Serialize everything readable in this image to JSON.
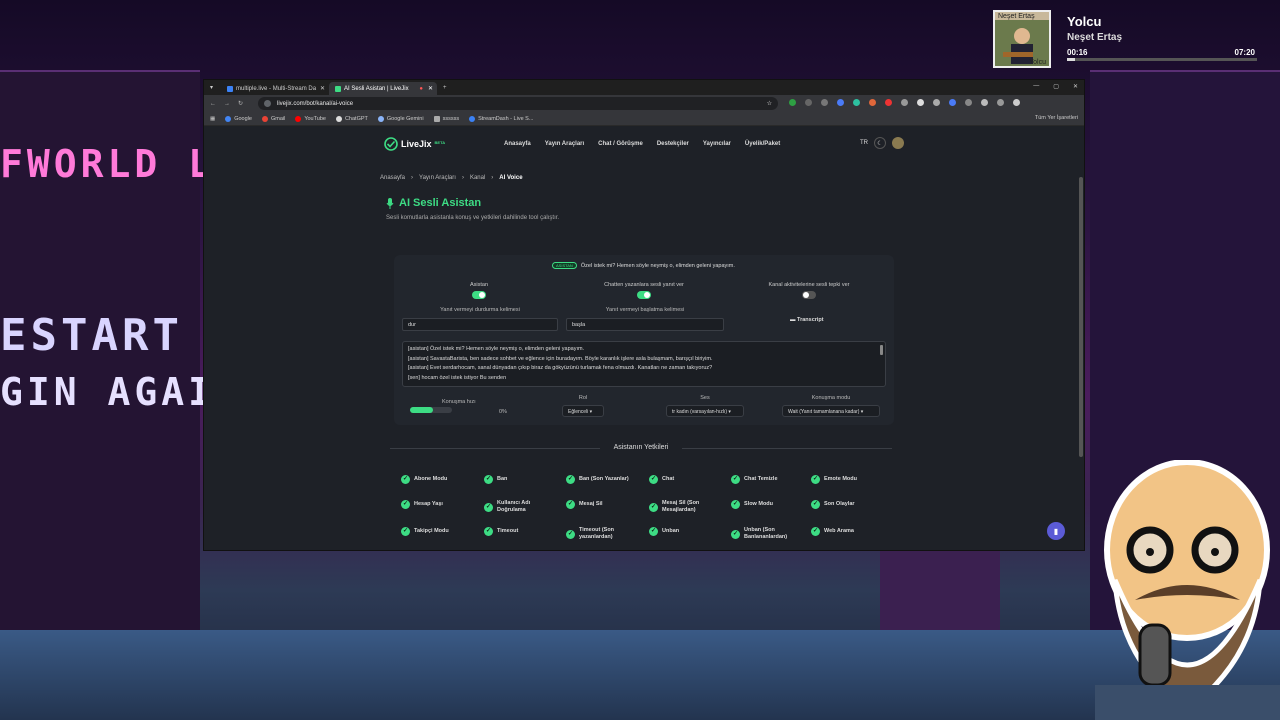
{
  "scene": {
    "signs": {
      "left_top": "FWORLD L",
      "left_mid": "ESTART",
      "left_mid2": "GIN AGAIN"
    }
  },
  "now_playing": {
    "cover_top": "Neşet Ertaş",
    "cover_bottom": "Yolcu",
    "title": "Yolcu",
    "artist": "Neşet Ertaş",
    "elapsed": "00:16",
    "total": "07:20",
    "progress": 0.04
  },
  "browser": {
    "tabs": [
      {
        "label": "multiple.live - Multi-Stream Da"
      },
      {
        "label": "AI Sesli Asistan | LiveJix"
      }
    ],
    "url": "livejix.com/bot/kanal/ai-voice",
    "bookmarks": [
      "Google",
      "Gmail",
      "YouTube",
      "ChatGPT",
      "Google Gemini",
      "ssssss",
      "StreamDash - Live S..."
    ],
    "all_bookmarks": "Tüm Yer İşaretleri"
  },
  "site": {
    "logo": "LiveJix",
    "beta": "BETA",
    "menu": [
      "Anasayfa",
      "Yayın Araçları",
      "Chat / Görüşme",
      "Destekçiler",
      "Yayıncılar",
      "Üyelik/Paket"
    ],
    "lang": "TR"
  },
  "breadcrumb": [
    "Anasayfa",
    "Yayın Araçları",
    "Kanal",
    "AI Voice"
  ],
  "page": {
    "title": "AI Sesli Asistan",
    "subtitle": "Sesli komutlarla asistanla konuş ve yetkileri dahilinde tool çalıştır."
  },
  "panel": {
    "status_pill": "ASİSTAN",
    "status_text": "Özel istek mi? Hemen söyle neymiş o, elimden geleni yapayım.",
    "toggles": [
      {
        "label": "Asistan",
        "on": true
      },
      {
        "label": "Chatten yazanlara sesli yanıt ver",
        "on": true
      },
      {
        "label": "Kanal aktivitelerine sesli tepki ver",
        "on": false
      }
    ],
    "stop_label": "Yanıt vermeyi durdurma kelimesi",
    "stop_value": "dur",
    "start_label": "Yanıt vermeyi başlatma kelimesi",
    "start_value": "başla",
    "transcript": "Transcript",
    "log": [
      "[asistan] Özel istek mi? Hemen söyle neymiş o, elimden geleni yapayım.",
      "[asistan] SavastaBarista, ben sadece sohbet ve eğlence için buradayım. Böyle karanlık işlere asla bulaşmam, barışçıl biriyim.",
      "[asistan] Evet serdarhocam, sanal dünyadan çıkıp biraz da gökyüzünü turlamak fena olmazdı. Kanatları ne zaman takıyoruz?",
      "[sen] hocam özel istek istiyor Bu senden"
    ],
    "speed_label": "Konuşma hızı",
    "speed_value": "0%",
    "speed_fill": 0.55,
    "role_label": "Rol",
    "role_value": "Eğlenceli ▾",
    "voice_label": "Ses",
    "voice_value": "tr kadın (varsayılan-hızlı) ▾",
    "mode_label": "Konuşma modu",
    "mode_value": "Wait (Yanıt tamamlanana kadar) ▾"
  },
  "permissions": {
    "title": "Asistanın Yetkileri",
    "items": [
      "Abone Modu",
      "Ban",
      "Ban (Son Yazanlar)",
      "Chat",
      "Chat Temizle",
      "Emote Modu",
      "Hesap Yaşı",
      "Kullanıcı Adı Doğrulama",
      "Mesaj Sil",
      "Mesaj Sil (Son Mesajlardan)",
      "Slow Modu",
      "Son Olaylar",
      "Takipçi Modu",
      "Timeout",
      "Timeout (Son yazanlardan)",
      "Unban",
      "Unban (Son Banlananlardan)",
      "Web Arama"
    ]
  }
}
